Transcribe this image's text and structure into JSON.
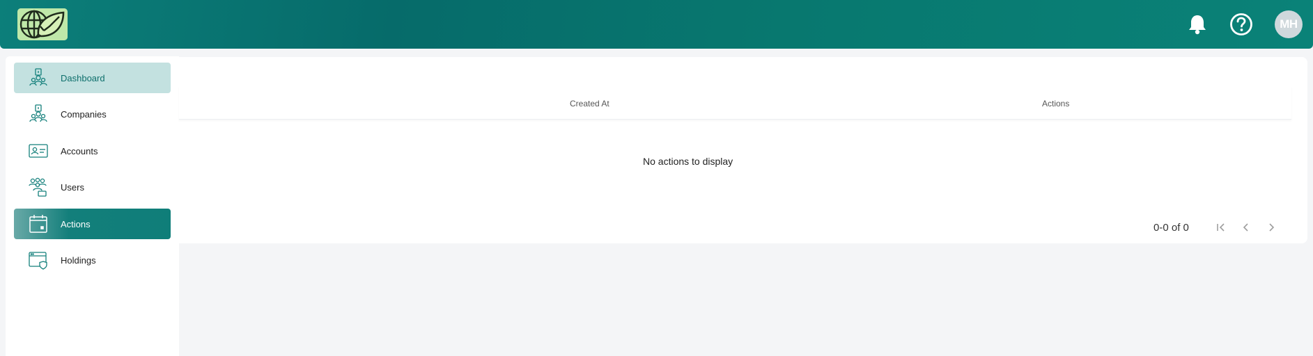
{
  "header": {
    "logo": "leaf-globe-logo",
    "notifications_icon": "bell-icon",
    "help_icon": "question-circle-icon",
    "avatar_initials": "MH"
  },
  "sidebar": {
    "items": [
      {
        "label": "Dashboard",
        "icon": "dashboard-people-icon",
        "state": "highlighted"
      },
      {
        "label": "Companies",
        "icon": "companies-people-icon",
        "state": "normal"
      },
      {
        "label": "Accounts",
        "icon": "id-card-icon",
        "state": "normal"
      },
      {
        "label": "Users",
        "icon": "users-group-icon",
        "state": "normal"
      },
      {
        "label": "Actions",
        "icon": "calendar-icon",
        "state": "active"
      },
      {
        "label": "Holdings",
        "icon": "browser-shield-icon",
        "state": "normal"
      }
    ]
  },
  "table": {
    "columns": [
      "Created At",
      "Actions"
    ],
    "empty_message": "No actions to display",
    "pagination": {
      "range": "0-0 of 0",
      "first_icon": "first-page-icon",
      "prev_icon": "chevron-left-icon",
      "next_icon": "chevron-right-icon"
    }
  },
  "colors": {
    "brand_teal": "#0a7a74",
    "active_nav": "#137f7b",
    "highlight_nav": "#c3e1e0",
    "background": "#f4f5f7"
  }
}
